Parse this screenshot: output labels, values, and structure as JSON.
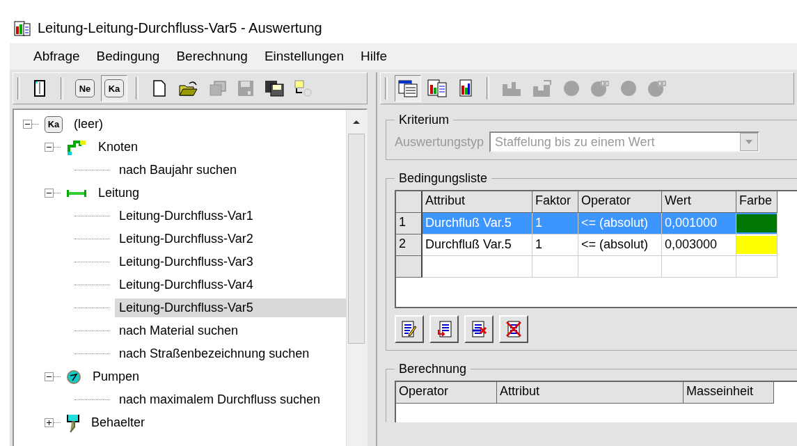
{
  "window": {
    "title": "Leitung-Leitung-Durchfluss-Var5 - Auswertung"
  },
  "menu": [
    "Abfrage",
    "Bedingung",
    "Berechnung",
    "Einstellungen",
    "Hilfe"
  ],
  "left_toolbar": {
    "groups": [
      {
        "buttons": [
          {
            "kind": "door",
            "pressed": false,
            "disabled": false
          }
        ]
      },
      {
        "buttons": [
          {
            "kind": "tag",
            "label": "Ne",
            "pressed": false,
            "disabled": false
          },
          {
            "kind": "tag",
            "label": "Ka",
            "pressed": true,
            "disabled": false
          }
        ]
      },
      {
        "buttons": [
          {
            "kind": "new",
            "pressed": false,
            "disabled": false
          },
          {
            "kind": "open",
            "pressed": false,
            "disabled": false
          },
          {
            "kind": "copy",
            "pressed": false,
            "disabled": true
          },
          {
            "kind": "save",
            "pressed": false,
            "disabled": true
          },
          {
            "kind": "saveall",
            "pressed": false,
            "disabled": false
          },
          {
            "kind": "export",
            "pressed": false,
            "disabled": false
          }
        ]
      }
    ]
  },
  "tree": [
    {
      "kind": "ka",
      "icon_label": "Ka",
      "label": "(leer)",
      "expanded": true,
      "selected": false,
      "children": [
        {
          "kind": "knoten",
          "label": "Knoten",
          "expanded": true,
          "selected": false,
          "children": [
            {
              "label": "nach Baujahr suchen",
              "selected": false
            }
          ]
        },
        {
          "kind": "leitung",
          "label": "Leitung",
          "expanded": true,
          "selected": false,
          "children": [
            {
              "label": "Leitung-Durchfluss-Var1",
              "selected": false
            },
            {
              "label": "Leitung-Durchfluss-Var2",
              "selected": false
            },
            {
              "label": "Leitung-Durchfluss-Var3",
              "selected": false
            },
            {
              "label": "Leitung-Durchfluss-Var4",
              "selected": false
            },
            {
              "label": "Leitung-Durchfluss-Var5",
              "selected": true
            },
            {
              "label": "nach Material suchen",
              "selected": false
            },
            {
              "label": "nach Straßenbezeichnung suchen",
              "selected": false
            }
          ]
        },
        {
          "kind": "pumpen",
          "label": "Pumpen",
          "expanded": true,
          "selected": false,
          "children": [
            {
              "label": "nach maximalem Durchfluss suchen",
              "selected": false
            }
          ]
        },
        {
          "kind": "behaelter",
          "label": "Behaelter",
          "expanded": false,
          "selected": false
        }
      ]
    }
  ],
  "right_toolbar": {
    "groups": [
      {
        "buttons": [
          {
            "kind": "table",
            "pressed": true,
            "disabled": false
          },
          {
            "kind": "charttable",
            "pressed": false,
            "disabled": false
          },
          {
            "kind": "chart",
            "pressed": false,
            "disabled": false
          }
        ]
      },
      {
        "buttons": [
          {
            "kind": "bars",
            "pressed": false,
            "disabled": true
          },
          {
            "kind": "bars3d",
            "pressed": false,
            "disabled": true
          },
          {
            "kind": "pie",
            "pressed": false,
            "disabled": true
          },
          {
            "kind": "pie3d",
            "pressed": false,
            "disabled": true
          },
          {
            "kind": "pie",
            "pressed": false,
            "disabled": true
          },
          {
            "kind": "pie3d",
            "pressed": false,
            "disabled": true
          }
        ]
      }
    ]
  },
  "kriterium": {
    "title": "Kriterium",
    "label": "Auswertungstyp",
    "value": "Staffelung bis zu einem Wert",
    "disabled": true
  },
  "bedingungsliste": {
    "title": "Bedingungsliste",
    "columns": [
      "Attribut",
      "Faktor",
      "Operator",
      "Wert",
      "Farbe"
    ],
    "rows": [
      {
        "number": "1",
        "attribut": "Durchfluß Var.5",
        "faktor": "1",
        "operator": "<= (absolut)",
        "wert": "0,001000",
        "color": "#007700",
        "selected": true
      },
      {
        "number": "2",
        "attribut": "Durchfluß Var.5",
        "faktor": "1",
        "operator": "<= (absolut)",
        "wert": "0,003000",
        "color": "#ffff00",
        "selected": false
      }
    ],
    "buttons": [
      {
        "kind": "edit"
      },
      {
        "kind": "insert"
      },
      {
        "kind": "delete"
      },
      {
        "kind": "clear"
      }
    ]
  },
  "berechnung": {
    "title": "Berechnung",
    "columns": [
      "Operator",
      "Attribut",
      "Masseinheit"
    ]
  }
}
